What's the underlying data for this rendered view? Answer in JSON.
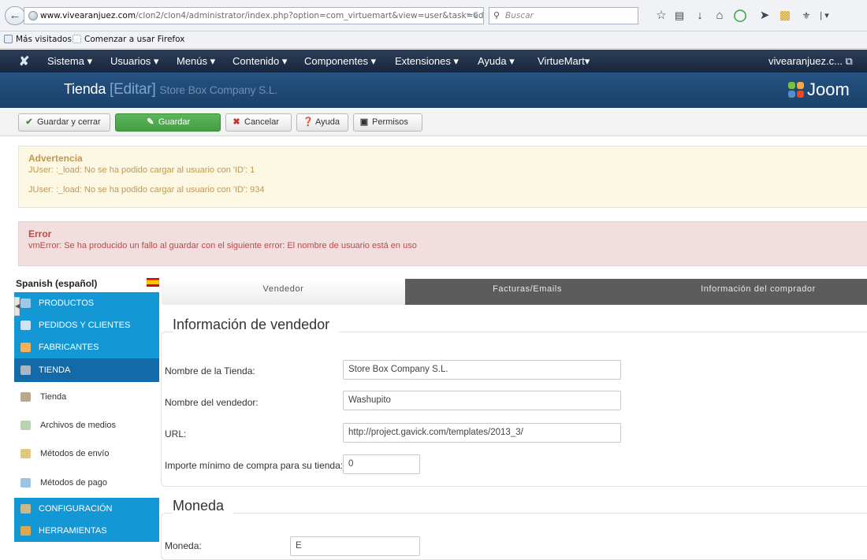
{
  "browser": {
    "url_host": "www.vivearanjuez.com",
    "url_path": "/clon2/clon4/administrator/index.php?option=com_virtuemart&view=user&task=ed",
    "search_placeholder": "Buscar",
    "bookmarks": [
      "Más visitados",
      "Comenzar a usar Firefox"
    ]
  },
  "nav": {
    "items": [
      "Sistema ▾",
      "Usuarios ▾",
      "Menús ▾",
      "Contenido ▾",
      "Componentes ▾",
      "Extensiones ▾",
      "Ayuda ▾",
      "VirtueMart▾"
    ],
    "user": "vivearanjuez.c... ⧉"
  },
  "header": {
    "title": "Tienda",
    "bracket_open": "[",
    "action": "Editar",
    "bracket_close": "]",
    "store_name": "Store Box Company S.L.",
    "brand": "Joom"
  },
  "toolbar": {
    "save_close": "Guardar y cerrar",
    "save": "Guardar",
    "cancel": "Cancelar",
    "help": "Ayuda",
    "permissions": "Permisos"
  },
  "warning": {
    "heading": "Advertencia",
    "lines": [
      "JUser: :_load: No se ha podido cargar al usuario con 'ID': 1",
      "JUser: :_load: No se ha podido cargar al usuario con 'ID': 934"
    ]
  },
  "error": {
    "heading": "Error",
    "line": "vmError: Se ha producido un fallo al guardar con el siguiente error: El nombre de usuario está en uso"
  },
  "sidebar": {
    "language": "Spanish (español)",
    "items": [
      {
        "label": "PRODUCTOS",
        "kind": "cat"
      },
      {
        "label": "PEDIDOS Y CLIENTES",
        "kind": "cat"
      },
      {
        "label": "FABRICANTES",
        "kind": "cat"
      },
      {
        "label": "TIENDA",
        "kind": "cat-active"
      },
      {
        "label": "Tienda",
        "kind": "sub"
      },
      {
        "label": "Archivos de medios",
        "kind": "sub"
      },
      {
        "label": "Métodos de envío",
        "kind": "sub"
      },
      {
        "label": "Métodos de pago",
        "kind": "sub"
      },
      {
        "label": "CONFIGURACIÓN",
        "kind": "cat"
      },
      {
        "label": "HERRAMIENTAS",
        "kind": "cat"
      }
    ]
  },
  "tabs": [
    "Vendedor",
    "Facturas/Emails",
    "Información del comprador"
  ],
  "vendor_section": {
    "legend": "Información de vendedor",
    "fields": [
      {
        "label": "Nombre de la Tienda:",
        "value": "Store Box Company S.L."
      },
      {
        "label": "Nombre del vendedor:",
        "value": "Washupito"
      },
      {
        "label": "URL:",
        "value": "http://project.gavick.com/templates/2013_3/"
      },
      {
        "label": "Importe mínimo de compra para su tienda:",
        "value": "0"
      }
    ]
  },
  "currency_section": {
    "legend": "Moneda",
    "partial_label": "Moneda:",
    "partial_value": "E"
  },
  "colors": {
    "nav_bg": "#1f2f48",
    "header_bg": "#205084",
    "sidebar_blue": "#1497d5",
    "warning_bg": "#fcf8e3",
    "error_bg": "#f2dede",
    "save_green": "#5cb85c"
  }
}
